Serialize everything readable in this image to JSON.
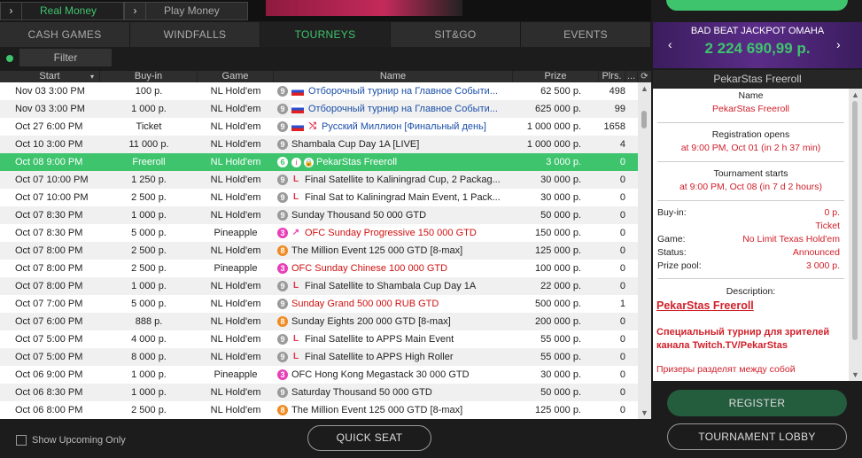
{
  "top_tabs": {
    "real_money": "Real Money",
    "play_money": "Play Money",
    "chevron": "›"
  },
  "nav_tabs": [
    "CASH GAMES",
    "WINDFALLS",
    "TOURNEYS",
    "SIT&GO",
    "EVENTS"
  ],
  "filter": {
    "label": "Filter"
  },
  "columns": {
    "start": "Start",
    "sort_arrow": "▾",
    "buyin": "Buy-in",
    "game": "Game",
    "name": "Name",
    "prize": "Prize",
    "players": "Plrs.",
    "more": "..."
  },
  "rows": [
    {
      "start": "Nov 03 3:00 PM",
      "buyin": "100 р.",
      "game": "NL Hold'em",
      "badge": "9",
      "badge_color": "gray",
      "tag": "flag-ru",
      "name": "Отборочный турнир на Главное Событи...",
      "name_color": "blue",
      "prize": "62 500 р.",
      "players": "498"
    },
    {
      "start": "Nov 03 3:00 PM",
      "buyin": "1 000 р.",
      "game": "NL Hold'em",
      "badge": "9",
      "badge_color": "gray",
      "tag": "flag-ru",
      "name": "Отборочный турнир на Главное Событи...",
      "name_color": "blue",
      "prize": "625 000 р.",
      "players": "99"
    },
    {
      "start": "Oct 27 6:00 PM",
      "buyin": "Ticket",
      "game": "NL Hold'em",
      "badge": "9",
      "badge_color": "gray",
      "tag": "flag-ru",
      "tag2": "⤭",
      "name": "Русский Миллион [Финальный день]",
      "name_color": "blue",
      "prize": "1 000 000 р.",
      "players": "1658"
    },
    {
      "start": "Oct 10 3:00 PM",
      "buyin": "11 000 р.",
      "game": "NL Hold'em",
      "badge": "9",
      "badge_color": "gray",
      "tag": "",
      "name": "Shambala Cup Day 1A [LIVE]",
      "name_color": "",
      "prize": "1 000 000 р.",
      "players": "4"
    },
    {
      "start": "Oct 08 9:00 PM",
      "buyin": "Freeroll",
      "game": "NL Hold'em",
      "badge": "6",
      "badge_color": "green6",
      "tag": "sicons",
      "name": "PekarStas Freeroll",
      "name_color": "",
      "prize": "3 000 р.",
      "players": "0",
      "selected": true
    },
    {
      "start": "Oct 07 10:00 PM",
      "buyin": "1 250 р.",
      "game": "NL Hold'em",
      "badge": "9",
      "badge_color": "gray",
      "tag": "L",
      "name": "Final Satellite to Kaliningrad Cup, 2 Packag...",
      "name_color": "",
      "prize": "30 000 р.",
      "players": "0"
    },
    {
      "start": "Oct 07 10:00 PM",
      "buyin": "2 500 р.",
      "game": "NL Hold'em",
      "badge": "9",
      "badge_color": "gray",
      "tag": "L",
      "name": "Final Sat to Kaliningrad Main Event, 1 Pack...",
      "name_color": "",
      "prize": "30 000 р.",
      "players": "0"
    },
    {
      "start": "Oct 07 8:30 PM",
      "buyin": "1 000 р.",
      "game": "NL Hold'em",
      "badge": "9",
      "badge_color": "gray",
      "tag": "",
      "name": "Sunday Thousand 50 000 GTD",
      "name_color": "",
      "prize": "50 000 р.",
      "players": "0"
    },
    {
      "start": "Oct 07 8:30 PM",
      "buyin": "5 000 р.",
      "game": "Pineapple",
      "badge": "3",
      "badge_color": "pink",
      "tag": "↗",
      "name": "OFC Sunday Progressive 150 000 GTD",
      "name_color": "red",
      "prize": "150 000 р.",
      "players": "0"
    },
    {
      "start": "Oct 07 8:00 PM",
      "buyin": "2 500 р.",
      "game": "NL Hold'em",
      "badge": "8",
      "badge_color": "orange",
      "tag": "",
      "name": "The Million Event 125 000 GTD [8-max]",
      "name_color": "",
      "prize": "125 000 р.",
      "players": "0"
    },
    {
      "start": "Oct 07 8:00 PM",
      "buyin": "2 500 р.",
      "game": "Pineapple",
      "badge": "3",
      "badge_color": "pink",
      "tag": "",
      "name": "OFC Sunday Chinese 100 000 GTD",
      "name_color": "red",
      "prize": "100 000 р.",
      "players": "0"
    },
    {
      "start": "Oct 07 8:00 PM",
      "buyin": "1 000 р.",
      "game": "NL Hold'em",
      "badge": "9",
      "badge_color": "gray",
      "tag": "L",
      "name": "Final Satellite to Shambala Cup Day 1A",
      "name_color": "",
      "prize": "22 000 р.",
      "players": "0"
    },
    {
      "start": "Oct 07 7:00 PM",
      "buyin": "5 000 р.",
      "game": "NL Hold'em",
      "badge": "9",
      "badge_color": "gray",
      "tag": "",
      "name": "Sunday Grand 500 000 RUB GTD",
      "name_color": "red",
      "prize": "500 000 р.",
      "players": "1"
    },
    {
      "start": "Oct 07 6:00 PM",
      "buyin": "888 р.",
      "game": "NL Hold'em",
      "badge": "8",
      "badge_color": "orange",
      "tag": "",
      "name": "Sunday Eights 200 000 GTD [8-max]",
      "name_color": "",
      "prize": "200 000 р.",
      "players": "0"
    },
    {
      "start": "Oct 07 5:00 PM",
      "buyin": "4 000 р.",
      "game": "NL Hold'em",
      "badge": "9",
      "badge_color": "gray",
      "tag": "L",
      "name": "Final Satellite to APPS Main Event",
      "name_color": "",
      "prize": "55 000 р.",
      "players": "0"
    },
    {
      "start": "Oct 07 5:00 PM",
      "buyin": "8 000 р.",
      "game": "NL Hold'em",
      "badge": "9",
      "badge_color": "gray",
      "tag": "L",
      "name": "Final Satellite to APPS High Roller",
      "name_color": "",
      "prize": "55 000 р.",
      "players": "0"
    },
    {
      "start": "Oct 06 9:00 PM",
      "buyin": "1 000 р.",
      "game": "Pineapple",
      "badge": "3",
      "badge_color": "pink",
      "tag": "",
      "name": "OFC Hong Kong Megastack 30 000 GTD",
      "name_color": "",
      "prize": "30 000 р.",
      "players": "0"
    },
    {
      "start": "Oct 06 8:30 PM",
      "buyin": "1 000 р.",
      "game": "NL Hold'em",
      "badge": "9",
      "badge_color": "gray",
      "tag": "",
      "name": "Saturday Thousand 50 000 GTD",
      "name_color": "",
      "prize": "50 000 р.",
      "players": "0"
    },
    {
      "start": "Oct 06 8:00 PM",
      "buyin": "2 500 р.",
      "game": "NL Hold'em",
      "badge": "8",
      "badge_color": "orange",
      "tag": "",
      "name": "The Million Event 125 000 GTD [8-max]",
      "name_color": "",
      "prize": "125 000 р.",
      "players": "0"
    }
  ],
  "bottom": {
    "show_upcoming": "Show Upcoming Only",
    "quick_seat": "QUICK SEAT"
  },
  "jackpot": {
    "title": "BAD BEAT JACKPOT OMAHA",
    "amount": "2 224 690,99 р.",
    "prev": "‹",
    "next": "›"
  },
  "details": {
    "title": "PekarStas Freeroll",
    "name_label": "Name",
    "name_value": "PekarStas Freeroll",
    "reg_label": "Registration opens",
    "reg_value": "at 9:00 PM, Oct 01 (in 2 h 37 min)",
    "starts_label": "Tournament starts",
    "starts_value": "at 9:00 PM, Oct 08 (in 7 d 2 hours)",
    "buyin_label": "Buy-in:",
    "buyin_value": "0 р.",
    "buyin_value2": "Ticket",
    "game_label": "Game:",
    "game_value": "No Limit Texas Hold'em",
    "status_label": "Status:",
    "status_value": "Announced",
    "prizepool_label": "Prize pool:",
    "prizepool_value": "3 000 р.",
    "desc_label": "Description:",
    "desc_heading": "PekarStas Freeroll",
    "desc_text": "Специальный турнир для зрителей канала Twitch.TV/PekarStas",
    "desc_text2": "Призеры разделят между собой"
  },
  "buttons": {
    "register": "REGISTER",
    "lobby": "TOURNAMENT LOBBY"
  },
  "colors": {
    "accent_green": "#3ec46d",
    "jackpot_purple": "#5a2c88",
    "alert_red": "#d0202a",
    "link_blue": "#1a4fa8"
  }
}
